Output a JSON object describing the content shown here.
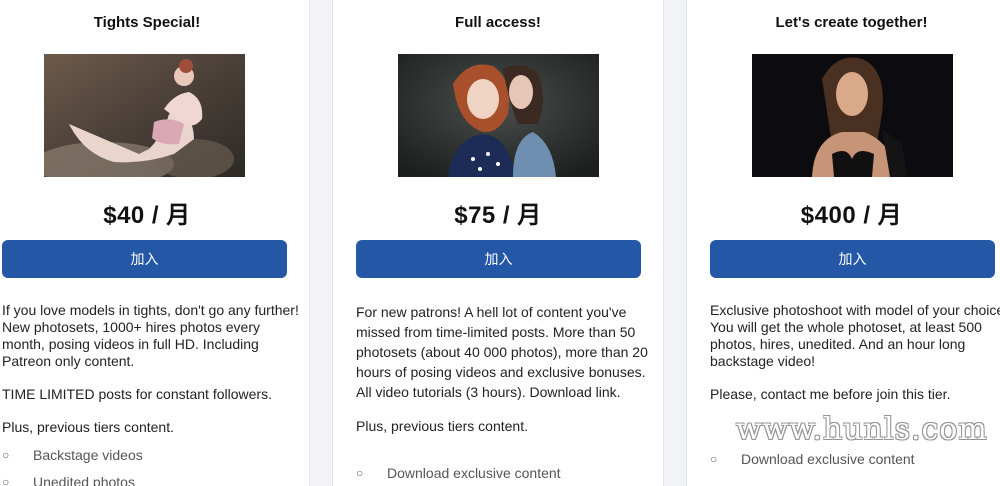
{
  "tiers": [
    {
      "title": "Tights Special!",
      "price": "$40 / 月",
      "join_label": "加入",
      "image_alt": "model in tights posing",
      "desc": [
        "If you love models in tights, don't go any further! New photosets, 1000+ hires photos every month, posing videos in full HD. Including Patreon only content.",
        "TIME LIMITED posts for constant followers.",
        "Plus, previous tiers content."
      ],
      "bullets": [
        "Backstage videos",
        "Unedited photos"
      ]
    },
    {
      "title": "Full access!",
      "price": "$75 / 月",
      "join_label": "加入",
      "image_alt": "two models embracing",
      "desc": [
        "For new patrons! A hell lot of content you've missed from time-limited posts. More than 50 photosets (about 40 000 photos), more than 20 hours of posing videos and exclusive bonuses. All video tutorials (3 hours). Download link.",
        "Plus, previous tiers content."
      ],
      "bullets": [
        "Download exclusive content"
      ]
    },
    {
      "title": "Let's create together!",
      "price": "$400 / 月",
      "join_label": "加入",
      "image_alt": "portrait of a model",
      "desc": [
        "Exclusive photoshoot with model of your choice! You will get the whole photoset, at least 500 photos, hires, unedited. And an hour long backstage video!",
        "Please, contact me before join this tier."
      ],
      "bullets": [
        "Download exclusive content"
      ]
    }
  ],
  "watermark": "www.hunls.com",
  "colors": {
    "button": "#2557a7",
    "page_bg": "#f2f3f7",
    "card_bg": "#ffffff"
  }
}
